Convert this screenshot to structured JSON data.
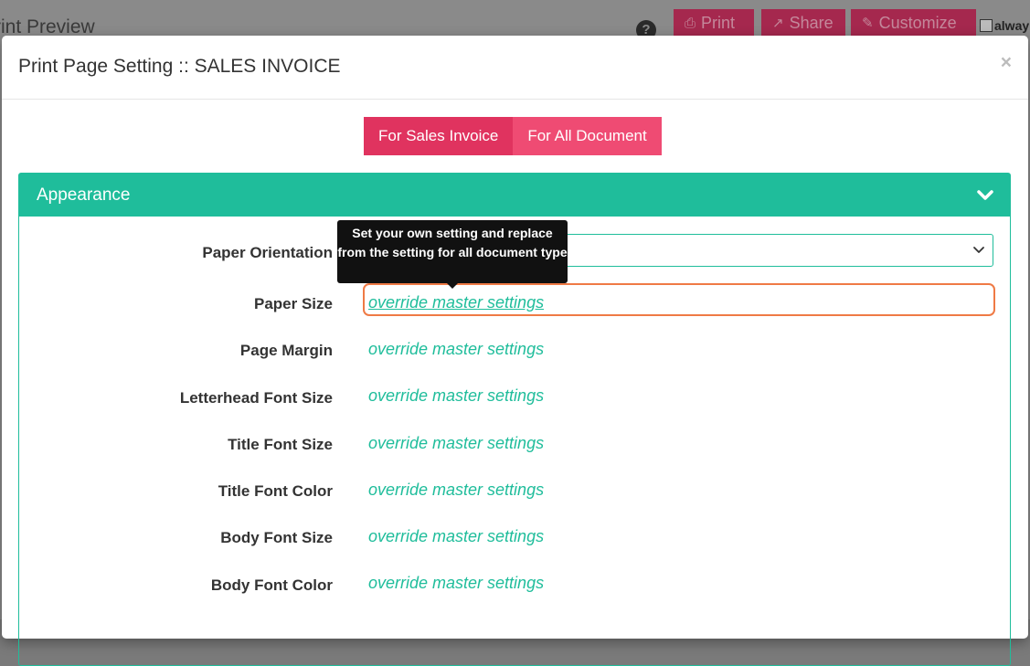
{
  "background": {
    "title": "rint Preview",
    "help_icon": "question-circle-icon",
    "buttons": [
      {
        "label": "Print",
        "icon": "printer-icon"
      },
      {
        "label": "Share",
        "icon": "share-icon"
      },
      {
        "label": "Customize",
        "icon": "brush-icon"
      }
    ],
    "always_label": "alway"
  },
  "modal": {
    "title": "Print Page Setting :: SALES INVOICE",
    "close": "×",
    "tabs": [
      {
        "label": "For Sales Invoice",
        "active": true
      },
      {
        "label": "For All Document",
        "active": false
      }
    ],
    "panel": {
      "title": "Appearance",
      "rows": [
        {
          "label": "Paper Orientation",
          "value": ""
        },
        {
          "label": "Paper Size",
          "value": "override master settings"
        },
        {
          "label": "Page Margin",
          "value": "override master settings"
        },
        {
          "label": "Letterhead Font Size",
          "value": "override master settings"
        },
        {
          "label": "Title Font Size",
          "value": "override master settings"
        },
        {
          "label": "Title Font Color",
          "value": "override master settings"
        },
        {
          "label": "Body Font Size",
          "value": "override master settings"
        },
        {
          "label": "Body Font Color",
          "value": "override master settings"
        }
      ]
    },
    "tooltip": "Set your own setting and replace from the setting for all document type"
  },
  "colors": {
    "accent": "#1fbd9b",
    "tab": "#ef4b73",
    "highlight": "#ef7a45"
  }
}
